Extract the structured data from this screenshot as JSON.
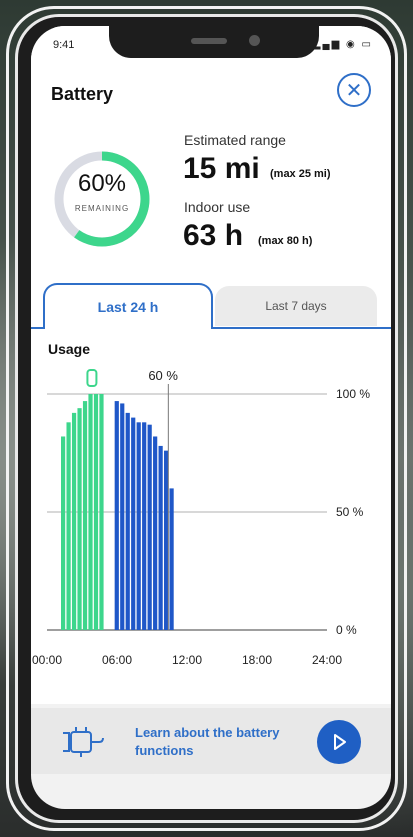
{
  "status": {
    "time": "9:41",
    "icons": "▂▄▆ ◉ ▭"
  },
  "header": {
    "title": "Battery",
    "close_icon": "close-icon"
  },
  "battery": {
    "percent_text": "60%",
    "remaining_label": "REMAINING",
    "level_fraction": 0.6,
    "estimated_range_label": "Estimated range",
    "estimated_range_value": "15 mi",
    "estimated_range_max": "(max 25 mi)",
    "indoor_use_label": "Indoor use",
    "indoor_use_value": "63 h",
    "indoor_use_max": "(max 80 h)"
  },
  "tabs": [
    {
      "label": "Last 24 h",
      "active": true
    },
    {
      "label": "Last 7 days",
      "active": false
    }
  ],
  "usage": {
    "label": "Usage"
  },
  "chart_data": {
    "type": "bar",
    "title": "",
    "xlabel": "",
    "ylabel": "",
    "x_tick_labels": [
      "00:00",
      "06:00",
      "12:00",
      "18:00",
      "24:00"
    ],
    "y_tick_labels": [
      "100 %",
      "50 %",
      "0 %"
    ],
    "ylim": [
      0,
      100
    ],
    "xlim_hours": [
      0,
      24
    ],
    "marker_label": "60 %",
    "marker_hour": 10.4,
    "series": [
      {
        "color": "#3dd68c",
        "start_hour": 1.2,
        "values": [
          82,
          88,
          92,
          94,
          97,
          100,
          100,
          100
        ]
      },
      {
        "color": "#1f57c8",
        "start_hour": 5.8,
        "values": [
          97,
          96,
          92,
          90,
          88,
          88,
          87,
          82,
          78,
          76,
          60
        ]
      }
    ],
    "bar_step_hours": 0.47,
    "grid": true
  },
  "banner": {
    "text": "Learn about the battery functions",
    "plug_icon": "plug-icon",
    "play_icon": "play-icon"
  },
  "colors": {
    "accent": "#2f6fc8",
    "charging": "#3dd68c",
    "discharging": "#1f57c8"
  }
}
